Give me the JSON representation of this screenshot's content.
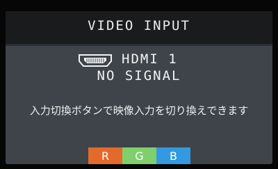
{
  "osd": {
    "title": "VIDEO INPUT",
    "input_label": "HDMI 1",
    "status": "NO SIGNAL",
    "message": "入力切換ボタンで映像入力を切り換えできます",
    "input_icon": "hdmi-connector-icon"
  },
  "rgb_bar": {
    "items": [
      {
        "label": "R",
        "color": "#e46a2b"
      },
      {
        "label": "G",
        "color": "#7fd06a"
      },
      {
        "label": "B",
        "color": "#3399e0"
      }
    ]
  }
}
